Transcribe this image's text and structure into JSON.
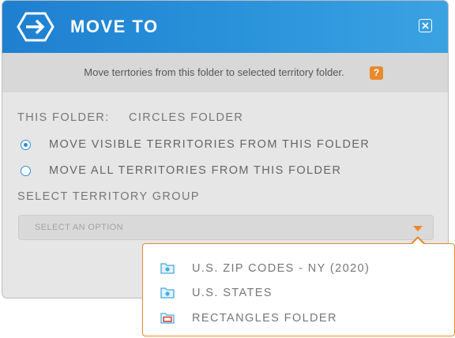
{
  "dialog": {
    "title": "MOVE TO",
    "info_text": "Move terrtories from this folder to selected territory folder.",
    "help_label": "?"
  },
  "folder": {
    "label": "THIS FOLDER:",
    "name": "CIRCLES FOLDER"
  },
  "options": {
    "visible_label": "MOVE VISIBLE TERRITORIES FROM THIS FOLDER",
    "all_label": "MOVE ALL TERRITORIES FROM THIS FOLDER",
    "selected": "visible"
  },
  "group": {
    "label": "SELECT TERRITORY GROUP",
    "placeholder": "SELECT AN OPTION"
  },
  "dropdown": {
    "items": [
      {
        "label": "U.S. ZIP CODES - NY (2020)",
        "icon": "folder-icon-blue"
      },
      {
        "label": "U.S. STATES",
        "icon": "folder-icon-blue"
      },
      {
        "label": "RECTANGLES FOLDER",
        "icon": "folder-icon-red"
      }
    ]
  },
  "colors": {
    "header_start": "#1f7fd0",
    "header_end": "#3ba2e2",
    "accent_orange": "#e88a2c",
    "radio_blue": "#2a8fd8",
    "folder_red": "#d9443a"
  }
}
